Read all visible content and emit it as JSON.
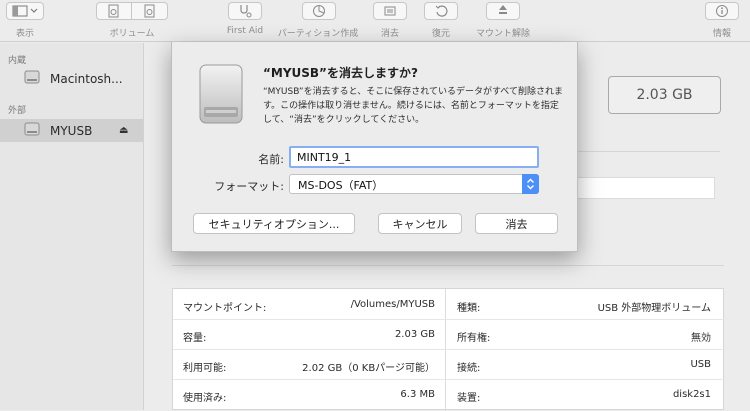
{
  "toolbar": {
    "view_label": "表示",
    "volume_label": "ボリューム",
    "firstaid_label": "First Aid",
    "partition_label": "パーティション作成",
    "erase_label": "消去",
    "restore_label": "復元",
    "unmount_label": "マウント解除",
    "info_label": "情報"
  },
  "sidebar": {
    "internal_header": "内蔵",
    "external_header": "外部",
    "internal_item": "Macintosh...",
    "external_item": "MYUSB"
  },
  "main": {
    "capacity_badge": "2.03 GB"
  },
  "dialog": {
    "title": "“MYUSB”を消去しますか?",
    "message": "“MYUSB”を消去すると、そこに保存されているデータがすべて削除されます。この操作は取り消せません。続けるには、名前とフォーマットを指定して、“消去”をクリックしてください。",
    "name_label": "名前:",
    "name_value": "MINT19_1",
    "format_label": "フォーマット:",
    "format_value": "MS-DOS（FAT）",
    "security_button": "セキュリティオプション...",
    "cancel_button": "キャンセル",
    "erase_button": "消去"
  },
  "info": {
    "left": [
      {
        "key": "マウントポイント:",
        "value": "/Volumes/MYUSB"
      },
      {
        "key": "容量:",
        "value": "2.03 GB"
      },
      {
        "key": "利用可能:",
        "value": "2.02 GB（0 KBパージ可能）"
      },
      {
        "key": "使用済み:",
        "value": "6.3 MB"
      }
    ],
    "right": [
      {
        "key": "種類:",
        "value": "USB 外部物理ボリューム"
      },
      {
        "key": "所有権:",
        "value": "無効"
      },
      {
        "key": "接続:",
        "value": "USB"
      },
      {
        "key": "装置:",
        "value": "disk2s1"
      }
    ]
  },
  "colors": {
    "accent": "#4c8ff6",
    "focus_ring": "#86aef0",
    "selection": "#d0d0d0"
  }
}
